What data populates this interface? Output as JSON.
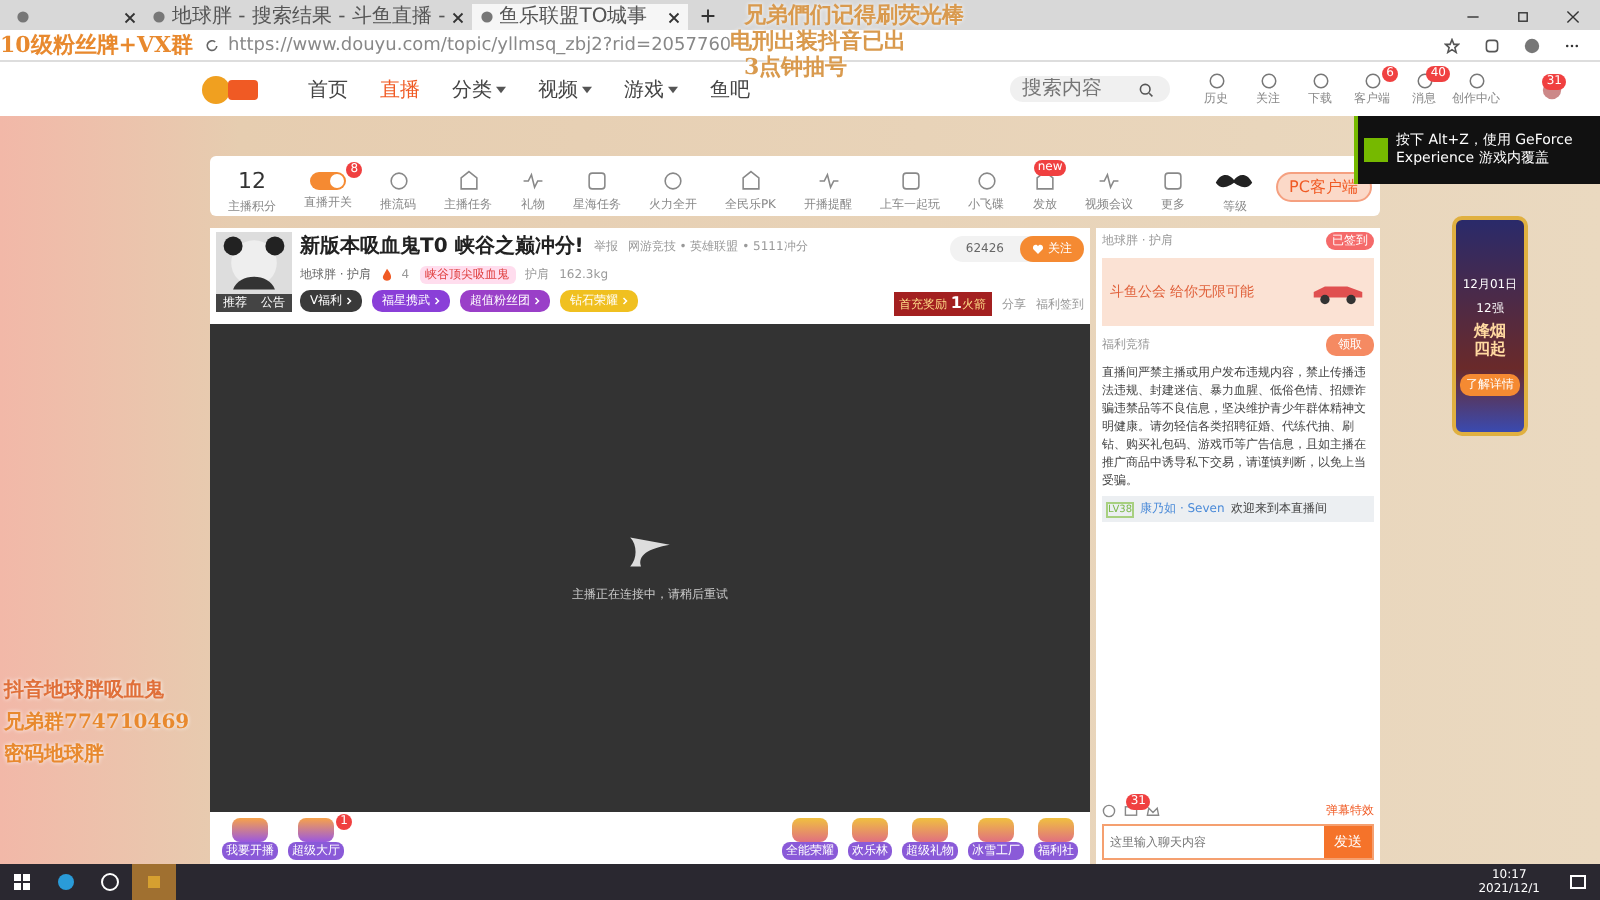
{
  "browser": {
    "tabs": [
      {
        "selected": false
      },
      {
        "title": "地球胖 - 搜索结果 - 斗鱼直播 -",
        "selected": false
      },
      {
        "title": "鱼乐联盟TO城事",
        "selected": true
      }
    ],
    "url": "https://www.douyu.com/topic/yllmsq_zbj2?rid=2057760"
  },
  "nav": {
    "items": [
      {
        "label": "首页",
        "selected": false,
        "dropdown": false
      },
      {
        "label": "直播",
        "selected": true,
        "dropdown": false
      },
      {
        "label": "分类",
        "selected": false,
        "dropdown": true
      },
      {
        "label": "视频",
        "selected": false,
        "dropdown": true
      },
      {
        "label": "游戏",
        "selected": false,
        "dropdown": true
      },
      {
        "label": "鱼吧",
        "selected": false,
        "dropdown": false
      }
    ],
    "search_placeholder": "搜索内容",
    "actions": [
      {
        "label": "历史"
      },
      {
        "label": "关注"
      },
      {
        "label": "下载"
      },
      {
        "label": "客户端",
        "badge": "6"
      },
      {
        "label": "消息",
        "badge": "40"
      },
      {
        "label": "创作中心"
      }
    ],
    "user_badge": "31"
  },
  "overlay_top": [
    {
      "text": "10级粉丝牌+VX群",
      "color": "#e8892e"
    },
    {
      "text": "兄弟們们记得刷荧光棒",
      "color": "#d99a4e"
    },
    {
      "text": "电刑出装抖音已出",
      "color": "#d99a4e"
    },
    {
      "text": "3点钟抽号",
      "color": "#d99a4e"
    }
  ],
  "overlay_left": [
    {
      "text": "抖音地球胖吸血鬼",
      "color": "#e0703a"
    },
    {
      "text": "兄弟群774710469",
      "color": "#e8892e"
    },
    {
      "text": "密码地球胖",
      "color": "#e8892e"
    }
  ],
  "nvidia_tip": "按下 Alt+Z，使用 GeForce Experience 游戏内覆盖",
  "toolbar": {
    "score": "12",
    "score_label": "主播积分",
    "items": [
      {
        "label": "直播开关",
        "kind": "toggle",
        "on": true,
        "badge": "8"
      },
      {
        "label": "推流码",
        "kind": "icon"
      },
      {
        "label": "主播任务",
        "kind": "icon"
      },
      {
        "label": "礼物",
        "kind": "icon"
      },
      {
        "label": "星海任务",
        "kind": "icon"
      },
      {
        "label": "火力全开",
        "kind": "icon"
      },
      {
        "label": "全民乐PK",
        "kind": "icon"
      },
      {
        "label": "开播提醒",
        "kind": "icon"
      },
      {
        "label": "上车一起玩",
        "kind": "icon"
      },
      {
        "label": "小飞碟",
        "kind": "icon"
      },
      {
        "label": "发放",
        "kind": "icon",
        "badge": "new"
      },
      {
        "label": "视频会议",
        "kind": "icon"
      },
      {
        "label": "更多",
        "kind": "icon"
      }
    ],
    "level_label": "等级",
    "client_button": "PC客户端"
  },
  "stream": {
    "avatar_tabs": [
      "推荐",
      "公告"
    ],
    "title": "新版本吸血鬼T0 峡谷之巅冲分!",
    "report": "举报",
    "category": "网游竞技 • 英雄联盟 • 5111冲分",
    "anchor": "地球胖 · 护肩",
    "heat": "4",
    "medal": "峡谷顶尖吸血鬼",
    "fans": "护肩",
    "weight": "162.3kg",
    "follows": "62426",
    "follow_label": "关注",
    "tags": [
      {
        "label": "V福利",
        "color": "#3a3a3a"
      },
      {
        "label": "福星携武",
        "color": "#8a3fd8"
      },
      {
        "label": "超值粉丝团",
        "color": "#9a3fc8"
      },
      {
        "label": "钻石荣耀",
        "color": "#f0c020"
      }
    ],
    "charge": {
      "label": "首充奖励",
      "amount": "1",
      "unit": "火箭"
    },
    "share": "分享",
    "signin": "福利签到",
    "video_message": "主播正在连接中，请稍后重试",
    "bottom_left": [
      {
        "label": "我要开播"
      },
      {
        "label": "超级大厅",
        "badge": "1"
      }
    ],
    "bottom_right": [
      {
        "label": "全能荣耀"
      },
      {
        "label": "欢乐林"
      },
      {
        "label": "超级礼物"
      },
      {
        "label": "冰雪工厂"
      },
      {
        "label": "福利社"
      }
    ]
  },
  "chat": {
    "anchor": "地球胖 · 护肩",
    "signed": "已签到",
    "banner": "斗鱼公会 给你无限可能",
    "quiz": "福利竞猜",
    "quiz_button": "领取",
    "notice": "直播间严禁主播或用户发布违规内容，禁止传播违法违规、封建迷信、暴力血腥、低俗色情、招嫖诈骗违禁品等不良信息，坚决维护青少年群体精神文明健康。请勿轻信各类招聘征婚、代练代抽、刷钻、购买礼包码、游戏币等广告信息，且如主播在推广商品中诱导私下交易，请谨慎判断，以免上当受骗。",
    "welcome": {
      "level": "LV38",
      "user": "康乃如 · Seven",
      "text": "欢迎来到本直播间"
    },
    "effects": "弹幕特效",
    "mail_badge": "31",
    "input_placeholder": "这里输入聊天内容",
    "send": "发送"
  },
  "event": {
    "date": "12月01日",
    "stage": "12强",
    "title": "烽烟四起",
    "button": "了解详情"
  },
  "taskbar": {
    "time": "10:17",
    "date": "2021/12/1"
  }
}
